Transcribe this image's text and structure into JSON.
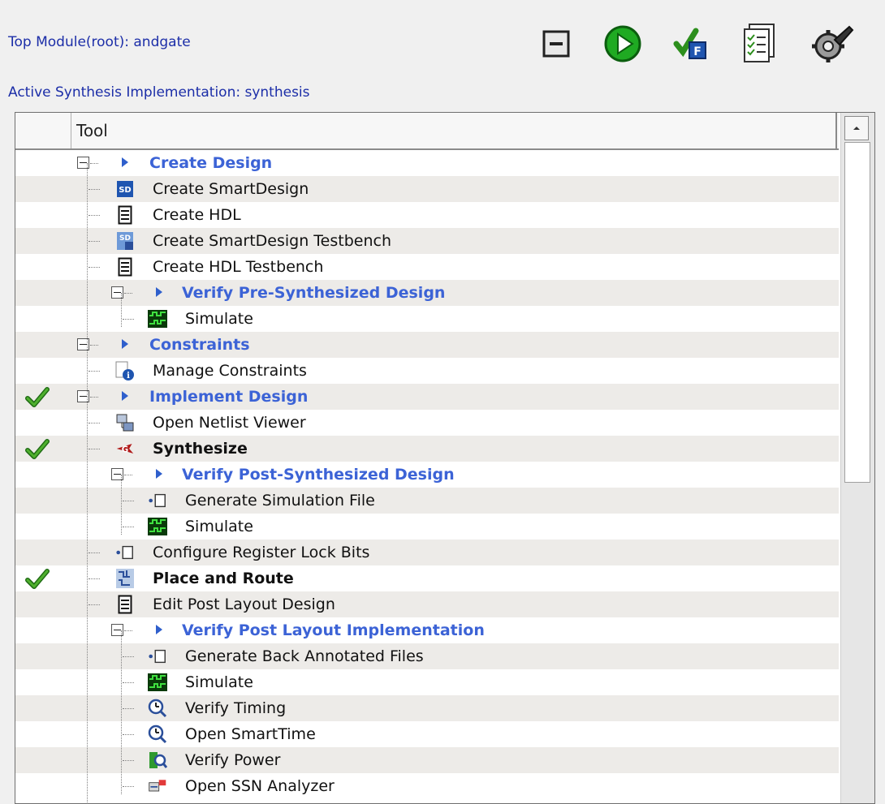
{
  "header": {
    "top_module": "Top Module(root): andgate",
    "active_impl": "Active Synthesis Implementation: synthesis"
  },
  "toolbar": {
    "buttons": [
      {
        "name": "collapse-all-button",
        "icon": "collapse-icon"
      },
      {
        "name": "run-button",
        "icon": "play-icon"
      },
      {
        "name": "flow-check-button",
        "icon": "flow-check-icon"
      },
      {
        "name": "report-button",
        "icon": "report-icon"
      },
      {
        "name": "options-button",
        "icon": "wrench-gear-icon"
      }
    ]
  },
  "table": {
    "column_tool": "Tool",
    "rows": [
      {
        "label": "Create Design",
        "type": "group",
        "level": 1,
        "checked": false,
        "icon": "arrow"
      },
      {
        "label": "Create SmartDesign",
        "type": "item",
        "level": 1,
        "checked": false,
        "icon": "smartdesign-icon"
      },
      {
        "label": "Create HDL",
        "type": "item",
        "level": 1,
        "checked": false,
        "icon": "document-icon"
      },
      {
        "label": "Create SmartDesign Testbench",
        "type": "item",
        "level": 1,
        "checked": false,
        "icon": "smartdesign-testbench-icon"
      },
      {
        "label": "Create HDL Testbench",
        "type": "item",
        "level": 1,
        "checked": false,
        "icon": "document-icon"
      },
      {
        "label": "Verify Pre-Synthesized Design",
        "type": "group",
        "level": 2,
        "checked": false,
        "icon": "arrow"
      },
      {
        "label": "Simulate",
        "type": "item",
        "level": 2,
        "checked": false,
        "icon": "waveform-icon"
      },
      {
        "label": "Constraints",
        "type": "group",
        "level": 1,
        "checked": false,
        "icon": "arrow"
      },
      {
        "label": "Manage Constraints",
        "type": "item",
        "level": 1,
        "checked": false,
        "icon": "constraint-icon"
      },
      {
        "label": "Implement Design",
        "type": "group",
        "level": 1,
        "checked": true,
        "icon": "arrow"
      },
      {
        "label": "Open Netlist Viewer",
        "type": "item",
        "level": 1,
        "checked": false,
        "icon": "netlist-icon"
      },
      {
        "label": "Synthesize",
        "type": "item-bold",
        "level": 1,
        "checked": true,
        "icon": "synthesize-icon"
      },
      {
        "label": "Verify Post-Synthesized Design",
        "type": "group",
        "level": 2,
        "checked": false,
        "icon": "arrow"
      },
      {
        "label": "Generate Simulation File",
        "type": "item",
        "level": 2,
        "checked": false,
        "icon": "generate-file-icon"
      },
      {
        "label": "Simulate",
        "type": "item",
        "level": 2,
        "checked": false,
        "icon": "waveform-icon"
      },
      {
        "label": "Configure Register Lock Bits",
        "type": "item",
        "level": 1,
        "checked": false,
        "icon": "generate-file-icon"
      },
      {
        "label": "Place and Route",
        "type": "item-bold",
        "level": 1,
        "checked": true,
        "icon": "place-route-icon"
      },
      {
        "label": "Edit Post Layout Design",
        "type": "item",
        "level": 1,
        "checked": false,
        "icon": "document-icon"
      },
      {
        "label": "Verify Post Layout Implementation",
        "type": "group",
        "level": 2,
        "checked": false,
        "icon": "arrow"
      },
      {
        "label": "Generate Back Annotated Files",
        "type": "item",
        "level": 2,
        "checked": false,
        "icon": "generate-file-icon"
      },
      {
        "label": "Simulate",
        "type": "item",
        "level": 2,
        "checked": false,
        "icon": "waveform-icon"
      },
      {
        "label": "Verify Timing",
        "type": "item",
        "level": 2,
        "checked": false,
        "icon": "timing-icon"
      },
      {
        "label": "Open SmartTime",
        "type": "item",
        "level": 2,
        "checked": false,
        "icon": "timing-icon"
      },
      {
        "label": "Verify Power",
        "type": "item",
        "level": 2,
        "checked": false,
        "icon": "power-icon"
      },
      {
        "label": "Open SSN Analyzer",
        "type": "item",
        "level": 2,
        "checked": false,
        "icon": "ssn-icon"
      }
    ]
  }
}
